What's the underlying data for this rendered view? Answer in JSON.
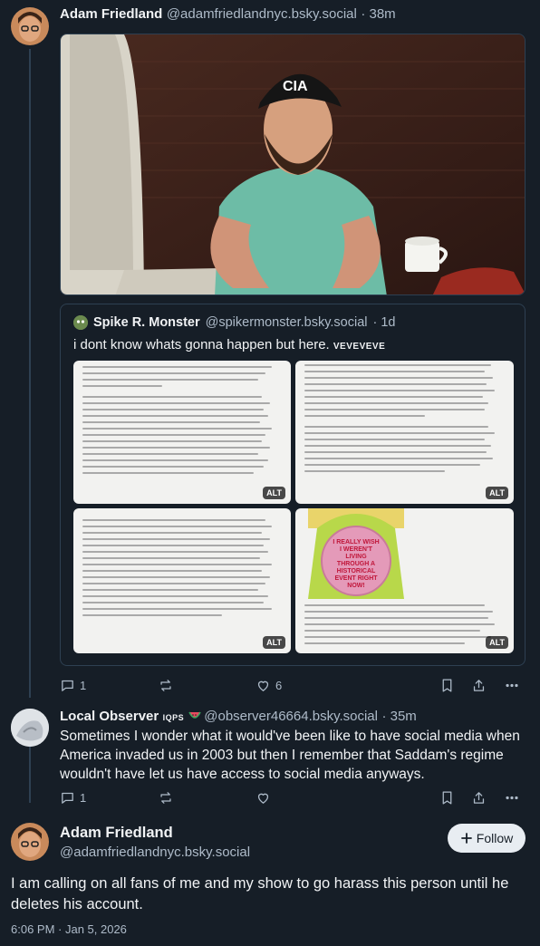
{
  "post1": {
    "author_name": "Adam Friedland",
    "author_handle": "@adamfriedlandnyc.bsky.social",
    "time": "· 38m",
    "image_cap_text": "CIA",
    "quote": {
      "author_name": "Spike R. Monster",
      "author_handle": "@spikermonster.bsky.social",
      "time": "· 1d",
      "text": "i dont know whats gonna happen but here.",
      "text_suffix": "VEVEVEVE",
      "images": [
        {
          "alt": "ALT"
        },
        {
          "alt": "ALT"
        },
        {
          "alt": "ALT"
        },
        {
          "alt": "ALT",
          "sign_text": "I REALLY WISH I WEREN'T LIVING THROUGH A HISTORICAL EVENT RIGHT NOW!"
        }
      ]
    },
    "actions": {
      "replies": "1",
      "likes": "6"
    }
  },
  "post2": {
    "author_name": "Local Observer",
    "author_name_suffix": "IQPS",
    "author_handle": "@observer46664.bsky.social",
    "time": "· 35m",
    "text": "Sometimes I wonder what it would've been like to have social media when America invaded us in 2003 but then I remember that Saddam's regime wouldn't have let us have access to social media anyways.",
    "actions": {
      "replies": "1"
    }
  },
  "post3": {
    "author_name": "Adam Friedland",
    "author_handle": "@adamfriedlandnyc.bsky.social",
    "follow_label": "Follow",
    "text": "I am calling on all fans of me and my show to go harass this person until he deletes his account.",
    "timestamp": "6:06 PM · Jan 5, 2026"
  },
  "icons": [
    "reply-icon",
    "repost-icon",
    "like-icon",
    "bookmark-icon",
    "share-icon",
    "more-icon",
    "plus-icon"
  ]
}
